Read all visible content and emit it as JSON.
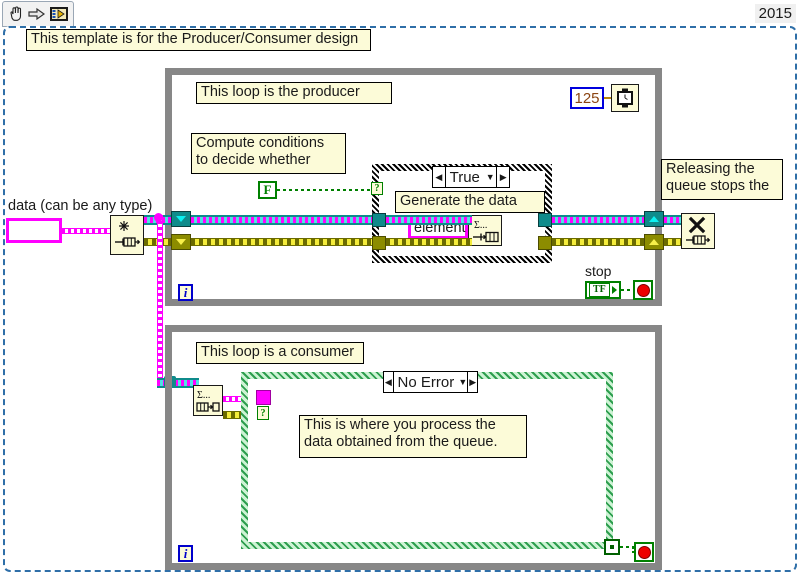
{
  "window": {
    "version_label": "2015"
  },
  "toolbar": {
    "items": [
      {
        "name": "hand-tool-icon",
        "label": "Hand"
      },
      {
        "name": "arrow-right-icon",
        "label": "Run arrow"
      },
      {
        "name": "labview-vi-icon",
        "label": "VI icon"
      }
    ]
  },
  "diagram": {
    "top_comment": "This template is for the Producer/Consumer design",
    "producer": {
      "title_comment": "This loop is the producer",
      "conditions_comment": "Compute conditions\nto decide whether",
      "wait_constant": "125",
      "wait_icon": "wait-ms-clock-icon",
      "false_constant": "F",
      "case_selector": {
        "value": "True",
        "left_arrow": "◀",
        "right_arrow": "▶",
        "down_arrow": "▼"
      },
      "case_comment": "Generate the data",
      "element_label": "element",
      "enqueue_icon": "enqueue-element-icon",
      "enqueue_glyph": "Σ...",
      "stop_label": "stop",
      "stop_terminal": "TF",
      "stop_condition_icon": "stop-loop-condition-icon",
      "iteration_terminal": "i",
      "selector_q": "?"
    },
    "consumer": {
      "title_comment": "This loop is a consumer",
      "dequeue_icon": "dequeue-element-icon",
      "dequeue_glyph": "Σ...",
      "case_selector": {
        "value": "No Error",
        "left_arrow": "◀",
        "right_arrow": "▶",
        "down_arrow": "▼"
      },
      "process_comment": "This is where you process the\ndata obtained from the queue.",
      "iteration_terminal": "i",
      "selector_q": "?",
      "stop_condition_icon": "stop-loop-condition-icon"
    },
    "left": {
      "data_label": "data (can be any type)",
      "obtain_queue_icon": "obtain-queue-icon"
    },
    "right": {
      "release_comment": "Releasing the\nqueue stops the",
      "release_queue_icon": "release-queue-icon",
      "release_glyph": "X"
    }
  },
  "colors": {
    "loop_frame": "#878787",
    "comment_bg": "#fcfbd8",
    "queue_wire": "#0f8b8b",
    "error_wire": "#8c8c00",
    "variant_wire": "#ff00ff",
    "boolean_wire": "#008000",
    "diagram_border": "#2f6fa8",
    "constant_border": "#0000dd"
  }
}
